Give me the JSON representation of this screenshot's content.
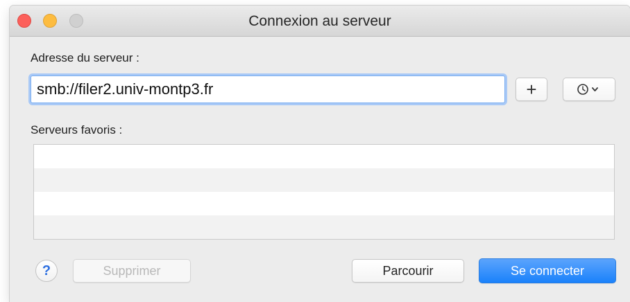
{
  "window": {
    "title": "Connexion au serveur"
  },
  "address": {
    "label": "Adresse du serveur :",
    "value": "smb://filer2.univ-montp3.fr"
  },
  "favorites": {
    "label": "Serveurs favoris :",
    "items": []
  },
  "buttons": {
    "add": "+",
    "help": "?",
    "delete": "Supprimer",
    "browse": "Parcourir",
    "connect": "Se connecter"
  },
  "icons": {
    "add": "plus-icon",
    "recent": "clock-icon",
    "recent_menu": "chevron-down-icon",
    "help": "question-icon"
  },
  "colors": {
    "accent": "#1a82fb",
    "close": "#fc605b",
    "minimize": "#fdbc40",
    "zoom_disabled": "#d0d0d0"
  }
}
